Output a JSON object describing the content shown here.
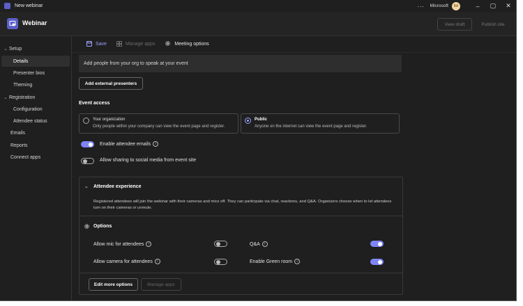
{
  "window": {
    "title": "New webinar",
    "org": "Microsoft",
    "avatar_initials": "BA"
  },
  "header": {
    "app_title": "Webinar",
    "view_draft": "View draft",
    "publish_site": "Publish site"
  },
  "sidebar": {
    "setup": "Setup",
    "details": "Details",
    "presenter_bios": "Presenter bios",
    "theming": "Theming",
    "registration": "Registration",
    "configuration": "Configuration",
    "attendee_status": "Attendee status",
    "emails": "Emails",
    "reports": "Reports",
    "connect_apps": "Connect apps"
  },
  "toolbar": {
    "save": "Save",
    "manage_apps": "Manage apps",
    "meeting_options": "Meeting options"
  },
  "banner_text": "Add people from your org to speak at your event",
  "add_external": "Add external presenters",
  "event_access": {
    "title": "Event access",
    "org_title": "Your organization",
    "org_desc": "Only people within your company can view the event page and register.",
    "public_title": "Public",
    "public_desc": "Anyone on the internet can view the event page and register.",
    "selected": "public"
  },
  "toggles": {
    "enable_attendee_emails": "Enable attendee emails",
    "allow_social": "Allow sharing to social media from event site"
  },
  "attendee_experience": {
    "title": "Attendee experience",
    "desc": "Registered attendees will join the webinar with their cameras and mics off. They can participate via chat, reactions, and Q&A. Organizers choose when to let attendees turn on their cameras or unmute.",
    "options_title": "Options",
    "mic": "Allow mic for attendees",
    "camera": "Allow camera for attendees",
    "qa": "Q&A",
    "green_room": "Enable Green room",
    "edit_more": "Edit more options",
    "manage_apps": "Manage apps"
  },
  "colors": {
    "accent": "#7f85f5",
    "brand": "#5b5fc7"
  }
}
